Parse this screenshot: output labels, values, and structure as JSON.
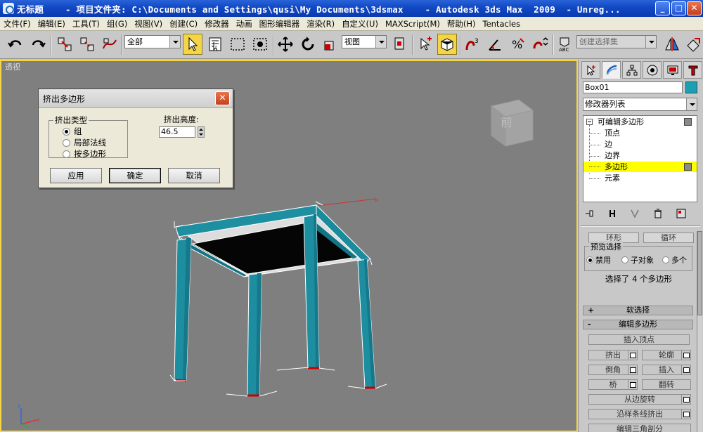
{
  "window": {
    "title": "无标题    - 项目文件夹: C:\\Documents and Settings\\qusi\\My Documents\\3dsmax    - Autodesk 3ds Max  2009  - Unreg...",
    "min_label": "_",
    "max_label": "□",
    "close_label": "✕"
  },
  "menu": [
    "文件(F)",
    "编辑(E)",
    "工具(T)",
    "组(G)",
    "视图(V)",
    "创建(C)",
    "修改器",
    "动画",
    "图形编辑器",
    "渲染(R)",
    "自定义(U)",
    "MAXScript(M)",
    "帮助(H)",
    "Tentacles"
  ],
  "toolbar": {
    "selection_filter": "全部",
    "reference_coord": "视图",
    "named_selection_placeholder": "创建选择集"
  },
  "viewport": {
    "label": "透视",
    "viewcube_label": "前"
  },
  "dialog": {
    "title": "挤出多边形",
    "close_label": "✕",
    "group_label": "挤出类型",
    "options": [
      "组",
      "局部法线",
      "按多边形"
    ],
    "selected_option": 0,
    "height_label": "挤出高度:",
    "height_value": "46.5",
    "apply_label": "应用",
    "ok_label": "确定",
    "cancel_label": "取消"
  },
  "command_panel": {
    "object_name": "Box01",
    "object_color": "#1aa0b3",
    "modifier_list": "修改器列表",
    "stack": {
      "root": "可编辑多边形",
      "children": [
        "顶点",
        "边",
        "边界",
        "多边形",
        "元素"
      ],
      "selected_child": 3
    },
    "selection": {
      "ring_label": "环形",
      "loop_label": "循环",
      "preview_label": "预览选择",
      "preview_options": [
        "禁用",
        "子对象",
        "多个"
      ],
      "status": "选择了 4 个多边形"
    },
    "rollouts": {
      "soft_selection": "软选择",
      "soft_selection_toggle": "+",
      "edit_polygons": "编辑多边形",
      "edit_polygons_toggle": "-"
    },
    "edit_polygons": {
      "insert_vertex": "插入顶点",
      "extrude": "挤出",
      "outline": "轮廓",
      "bevel": "倒角",
      "inset": "插入",
      "bridge": "桥",
      "flip": "翻转",
      "hinge_from_edge": "从边旋转",
      "extrude_along_spline": "沿样条线挤出",
      "edit_triangulation": "编辑三角剖分"
    }
  }
}
